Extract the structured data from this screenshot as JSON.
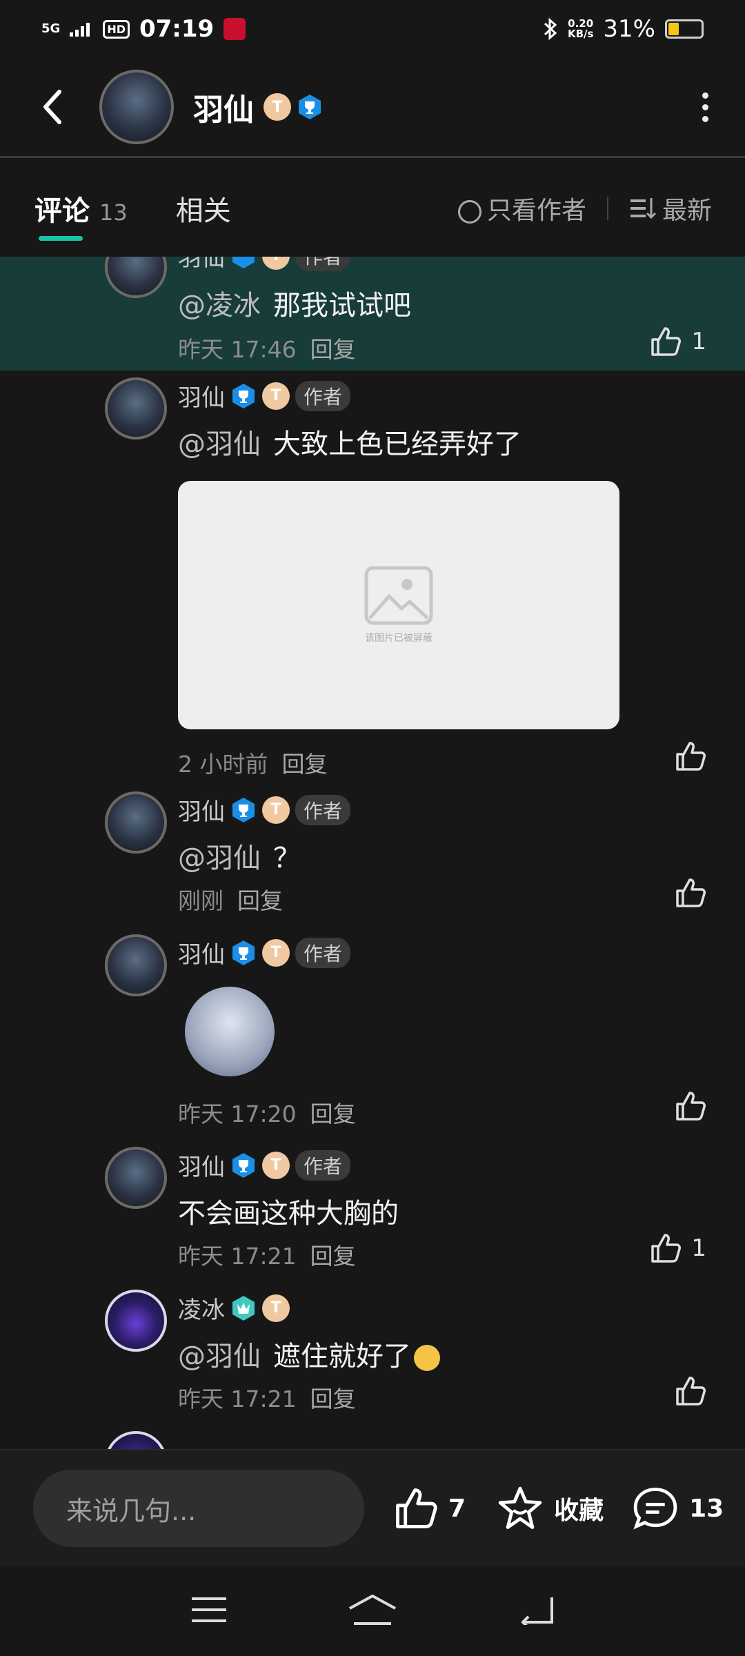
{
  "status_bar": {
    "network": "5G",
    "hd": "HD",
    "time": "07:19",
    "speed_value": "0.20",
    "speed_unit": "KB/s",
    "battery_text": "31%",
    "battery_level": 0.31
  },
  "header": {
    "title": "羽仙",
    "level_badge": "T"
  },
  "tabs": {
    "comments_label": "评论",
    "comments_count": "13",
    "related_label": "相关",
    "author_only_label": "只看作者",
    "sort_label": "最新"
  },
  "comments": [
    {
      "name": "羽仙",
      "author_tag": "作者",
      "mention": "@凌冰",
      "text": "那我试试吧",
      "time": "昨天 17:46",
      "reply": "回复",
      "likes": "1"
    },
    {
      "name": "羽仙",
      "author_tag": "作者",
      "mention": "@羽仙",
      "text": "大致上色已经弄好了",
      "image_caption": "该图片已被屏蔽",
      "time": "2 小时前",
      "reply": "回复",
      "likes": ""
    },
    {
      "name": "羽仙",
      "author_tag": "作者",
      "mention": "@羽仙",
      "text": "？",
      "time": "刚刚",
      "reply": "回复",
      "likes": ""
    },
    {
      "name": "羽仙",
      "author_tag": "作者",
      "time": "昨天 17:20",
      "reply": "回复",
      "likes": ""
    },
    {
      "name": "羽仙",
      "author_tag": "作者",
      "text": "不会画这种大胸的",
      "time": "昨天 17:21",
      "reply": "回复",
      "likes": "1"
    },
    {
      "name": "凌冰",
      "mention": "@羽仙",
      "text": "遮住就好了",
      "time": "昨天 17:21",
      "reply": "回复",
      "likes": ""
    }
  ],
  "bottom_bar": {
    "input_placeholder": "来说几句...",
    "like_count": "7",
    "favorite_label": "收藏",
    "comment_count": "13"
  },
  "colors": {
    "accent": "#19c3a6",
    "highlight_row": "#173c39",
    "badge_blue": "#1a8fe8",
    "badge_teal": "#3ec9c2",
    "level_badge": "#f0c9a2"
  }
}
